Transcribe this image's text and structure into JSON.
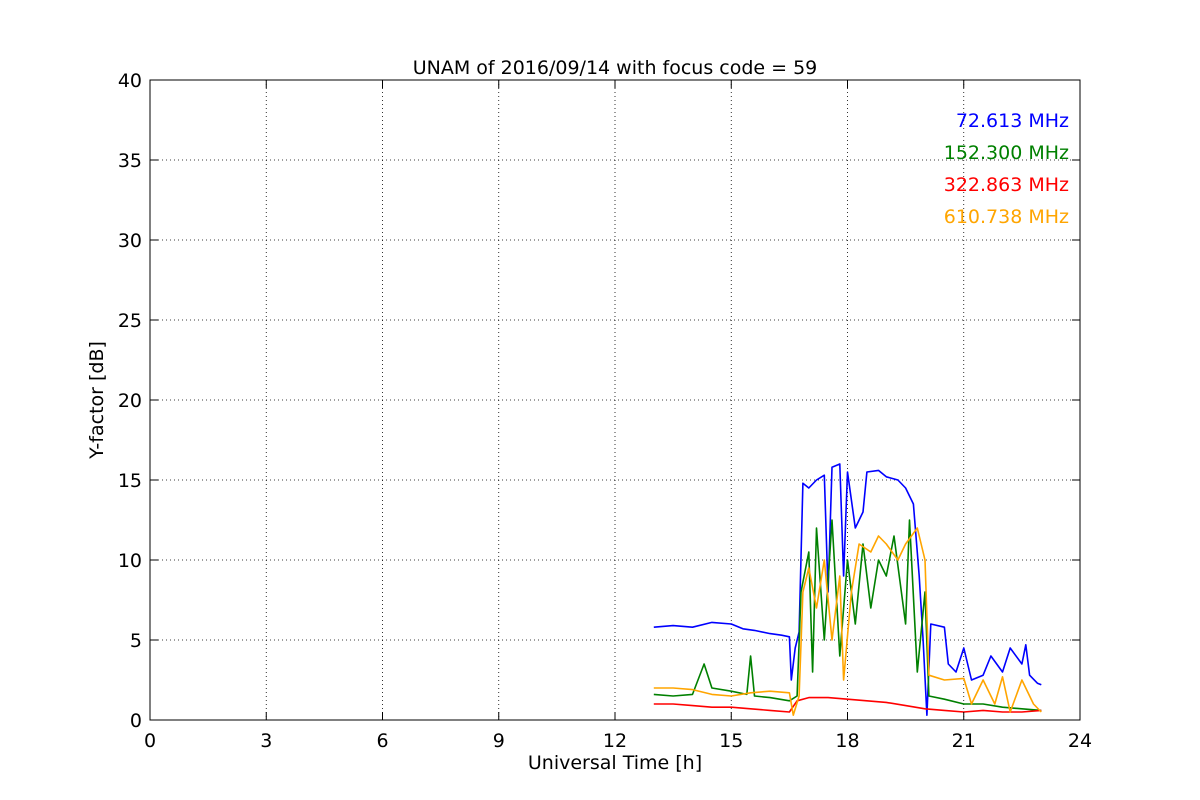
{
  "chart_data": {
    "type": "line",
    "title": "UNAM of 2016/09/14 with focus code = 59",
    "xlabel": "Universal Time [h]",
    "ylabel": "Y-factor [dB]",
    "xlim": [
      0,
      24
    ],
    "ylim": [
      0,
      40
    ],
    "x_ticks": [
      0,
      3,
      6,
      9,
      12,
      15,
      18,
      21,
      24
    ],
    "y_ticks": [
      0,
      5,
      10,
      15,
      20,
      25,
      30,
      35,
      40
    ],
    "x_tick_labels": [
      "0",
      "3",
      "6",
      "9",
      "12",
      "15",
      "18",
      "21",
      "24"
    ],
    "y_tick_labels": [
      "0",
      "5",
      "10",
      "15",
      "20",
      "25",
      "30",
      "35",
      "40"
    ],
    "grid": true,
    "legend_position": "top-right",
    "series": [
      {
        "name": "72.613 MHz",
        "color": "#0000ff",
        "points": [
          [
            13.0,
            5.8
          ],
          [
            13.5,
            5.9
          ],
          [
            14.0,
            5.8
          ],
          [
            14.5,
            6.1
          ],
          [
            15.0,
            6.0
          ],
          [
            15.3,
            5.7
          ],
          [
            15.6,
            5.6
          ],
          [
            16.0,
            5.4
          ],
          [
            16.3,
            5.3
          ],
          [
            16.5,
            5.2
          ],
          [
            16.55,
            2.5
          ],
          [
            16.65,
            4.5
          ],
          [
            16.75,
            5.5
          ],
          [
            16.85,
            14.8
          ],
          [
            17.0,
            14.5
          ],
          [
            17.2,
            15.0
          ],
          [
            17.4,
            15.3
          ],
          [
            17.5,
            8.0
          ],
          [
            17.6,
            15.8
          ],
          [
            17.8,
            16.0
          ],
          [
            17.9,
            9.0
          ],
          [
            18.0,
            15.5
          ],
          [
            18.2,
            12.0
          ],
          [
            18.4,
            13.0
          ],
          [
            18.5,
            15.5
          ],
          [
            18.8,
            15.6
          ],
          [
            19.0,
            15.2
          ],
          [
            19.3,
            15.0
          ],
          [
            19.5,
            14.5
          ],
          [
            19.7,
            13.5
          ],
          [
            19.85,
            9.0
          ],
          [
            19.95,
            5.0
          ],
          [
            20.05,
            0.3
          ],
          [
            20.15,
            6.0
          ],
          [
            20.5,
            5.8
          ],
          [
            20.6,
            3.5
          ],
          [
            20.8,
            3.0
          ],
          [
            21.0,
            4.5
          ],
          [
            21.2,
            2.5
          ],
          [
            21.5,
            2.8
          ],
          [
            21.7,
            4.0
          ],
          [
            22.0,
            3.0
          ],
          [
            22.2,
            4.5
          ],
          [
            22.5,
            3.5
          ],
          [
            22.6,
            4.7
          ],
          [
            22.7,
            2.8
          ],
          [
            22.9,
            2.3
          ],
          [
            23.0,
            2.2
          ]
        ]
      },
      {
        "name": "152.300 MHz",
        "color": "#008000",
        "points": [
          [
            13.0,
            1.6
          ],
          [
            13.5,
            1.5
          ],
          [
            14.0,
            1.6
          ],
          [
            14.3,
            3.5
          ],
          [
            14.5,
            2.0
          ],
          [
            15.0,
            1.8
          ],
          [
            15.4,
            1.6
          ],
          [
            15.5,
            4.0
          ],
          [
            15.6,
            1.5
          ],
          [
            16.0,
            1.4
          ],
          [
            16.5,
            1.2
          ],
          [
            16.7,
            1.5
          ],
          [
            16.8,
            8.0
          ],
          [
            17.0,
            10.5
          ],
          [
            17.1,
            3.0
          ],
          [
            17.2,
            12.0
          ],
          [
            17.4,
            5.0
          ],
          [
            17.6,
            12.5
          ],
          [
            17.8,
            4.0
          ],
          [
            18.0,
            10.0
          ],
          [
            18.2,
            6.0
          ],
          [
            18.4,
            11.0
          ],
          [
            18.6,
            7.0
          ],
          [
            18.8,
            10.0
          ],
          [
            19.0,
            9.0
          ],
          [
            19.2,
            11.5
          ],
          [
            19.5,
            6.0
          ],
          [
            19.6,
            12.5
          ],
          [
            19.8,
            3.0
          ],
          [
            20.0,
            8.0
          ],
          [
            20.1,
            1.5
          ],
          [
            20.5,
            1.3
          ],
          [
            21.0,
            1.0
          ],
          [
            21.5,
            1.0
          ],
          [
            22.0,
            0.8
          ],
          [
            22.5,
            0.7
          ],
          [
            23.0,
            0.6
          ]
        ]
      },
      {
        "name": "322.863 MHz",
        "color": "#ff0000",
        "points": [
          [
            13.0,
            1.0
          ],
          [
            13.5,
            1.0
          ],
          [
            14.0,
            0.9
          ],
          [
            14.5,
            0.8
          ],
          [
            15.0,
            0.8
          ],
          [
            15.5,
            0.7
          ],
          [
            16.0,
            0.6
          ],
          [
            16.5,
            0.5
          ],
          [
            16.7,
            1.2
          ],
          [
            17.0,
            1.4
          ],
          [
            17.5,
            1.4
          ],
          [
            18.0,
            1.3
          ],
          [
            18.5,
            1.2
          ],
          [
            19.0,
            1.1
          ],
          [
            19.5,
            0.9
          ],
          [
            20.0,
            0.7
          ],
          [
            20.5,
            0.6
          ],
          [
            21.0,
            0.5
          ],
          [
            21.5,
            0.6
          ],
          [
            22.0,
            0.5
          ],
          [
            22.5,
            0.5
          ],
          [
            23.0,
            0.6
          ]
        ]
      },
      {
        "name": "610.738 MHz",
        "color": "#ffa500",
        "points": [
          [
            13.0,
            2.0
          ],
          [
            13.5,
            2.0
          ],
          [
            14.0,
            1.9
          ],
          [
            14.5,
            1.6
          ],
          [
            15.0,
            1.5
          ],
          [
            15.5,
            1.7
          ],
          [
            16.0,
            1.8
          ],
          [
            16.5,
            1.7
          ],
          [
            16.6,
            0.3
          ],
          [
            16.75,
            1.5
          ],
          [
            16.85,
            8.0
          ],
          [
            17.0,
            9.5
          ],
          [
            17.2,
            7.0
          ],
          [
            17.4,
            10.0
          ],
          [
            17.6,
            5.0
          ],
          [
            17.8,
            9.0
          ],
          [
            17.9,
            2.5
          ],
          [
            18.1,
            8.0
          ],
          [
            18.3,
            11.0
          ],
          [
            18.6,
            10.5
          ],
          [
            18.8,
            11.5
          ],
          [
            19.0,
            11.0
          ],
          [
            19.3,
            10.0
          ],
          [
            19.5,
            11.0
          ],
          [
            19.8,
            12.0
          ],
          [
            20.0,
            10.0
          ],
          [
            20.1,
            2.8
          ],
          [
            20.5,
            2.5
          ],
          [
            21.0,
            2.6
          ],
          [
            21.2,
            1.0
          ],
          [
            21.5,
            2.5
          ],
          [
            21.8,
            1.0
          ],
          [
            22.0,
            2.7
          ],
          [
            22.2,
            0.5
          ],
          [
            22.5,
            2.5
          ],
          [
            22.8,
            1.0
          ],
          [
            23.0,
            0.5
          ]
        ]
      }
    ]
  }
}
